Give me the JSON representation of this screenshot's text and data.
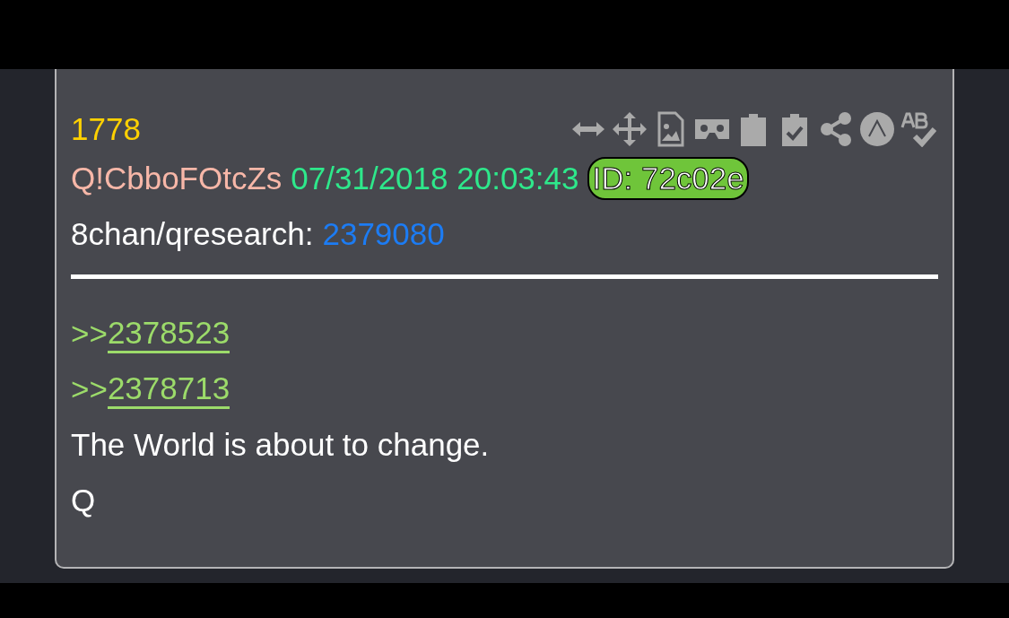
{
  "post": {
    "number": "1778",
    "author": "Q!CbboFOtcZs",
    "timestamp": "07/31/2018 20:03:43",
    "id_badge": "ID: 72c02e",
    "source": {
      "board": "8chan/qresearch:",
      "post_link": "2379080"
    },
    "replies": [
      {
        "marker": ">>",
        "link": "2378523"
      },
      {
        "marker": ">>",
        "link": "2378713"
      }
    ],
    "body": [
      "The World is about to change.",
      "Q"
    ]
  }
}
